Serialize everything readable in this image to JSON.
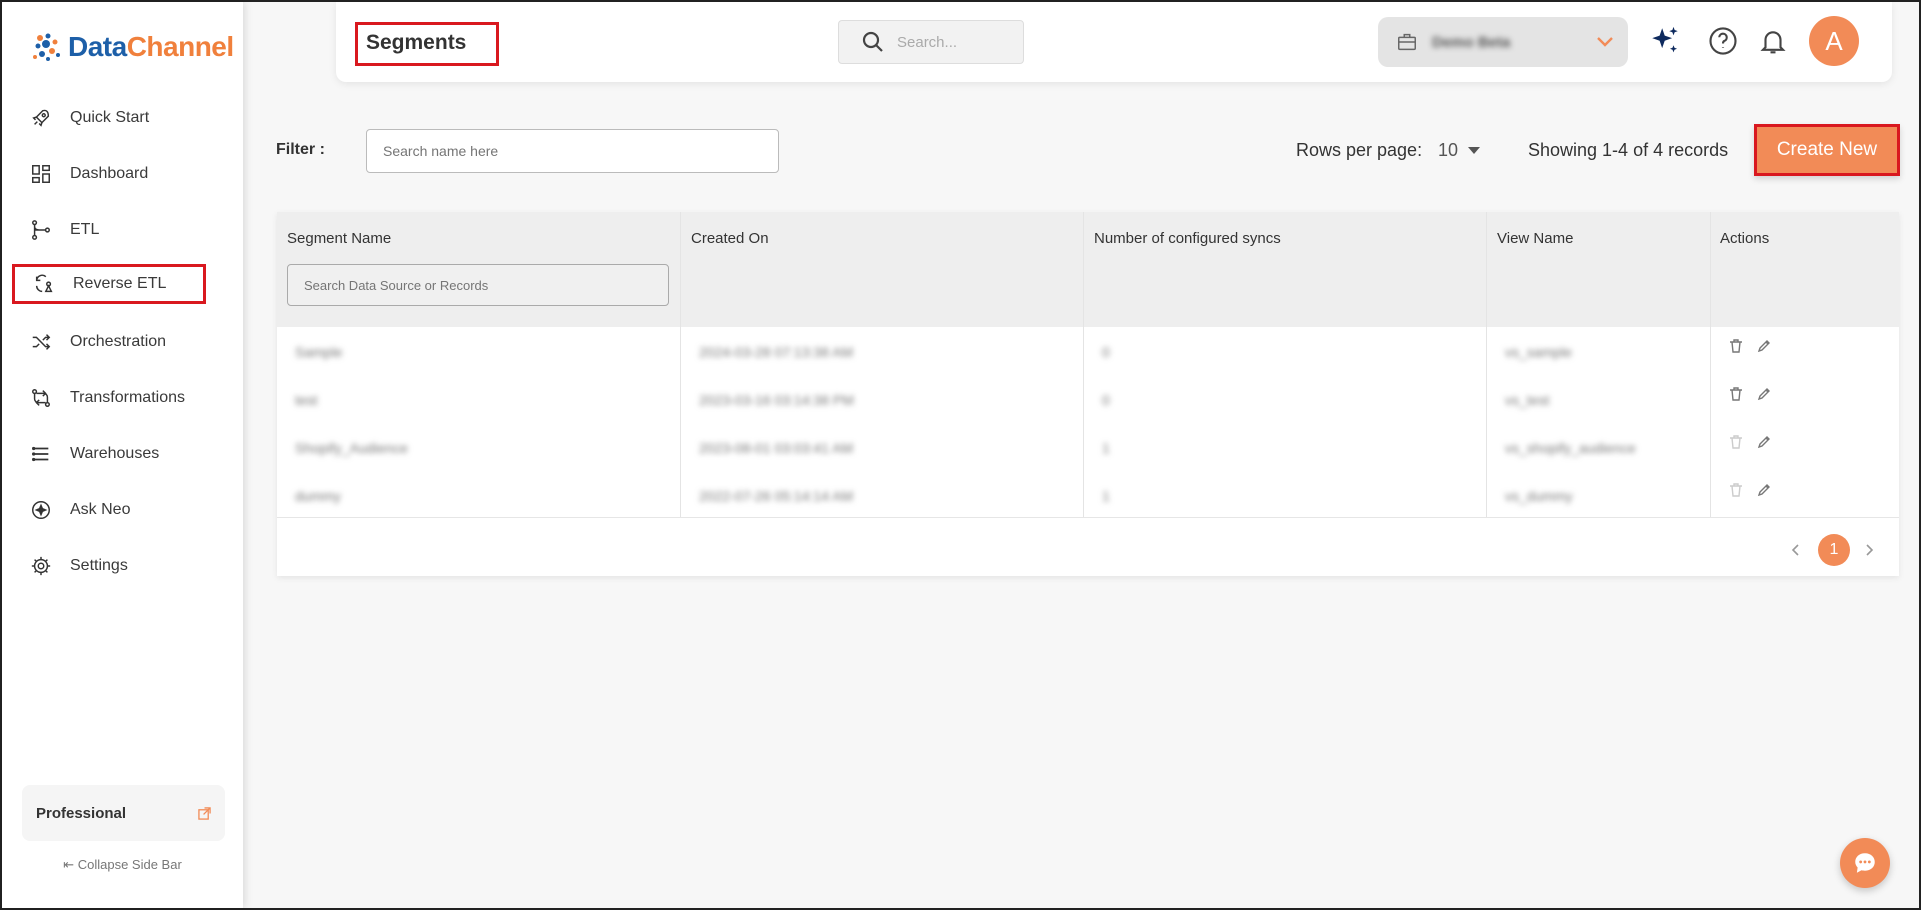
{
  "app": {
    "logo_part1": "Data",
    "logo_part2": "Channel"
  },
  "sidebar": {
    "items": [
      {
        "label": "Quick Start",
        "icon": "rocket-icon"
      },
      {
        "label": "Dashboard",
        "icon": "grid-icon"
      },
      {
        "label": "ETL",
        "icon": "flow-icon"
      },
      {
        "label": "Reverse ETL",
        "icon": "reverse-flow-icon"
      },
      {
        "label": "Orchestration",
        "icon": "shuffle-icon"
      },
      {
        "label": "Transformations",
        "icon": "transform-icon"
      },
      {
        "label": "Warehouses",
        "icon": "list-icon"
      },
      {
        "label": "Ask Neo",
        "icon": "sparkle-circle-icon"
      },
      {
        "label": "Settings",
        "icon": "gear-icon"
      }
    ],
    "plan": "Professional",
    "collapse": "Collapse Side Bar"
  },
  "header": {
    "title": "Segments",
    "search_placeholder": "Search...",
    "workspace": "Demo Beta",
    "avatar_letter": "A"
  },
  "toolbar": {
    "filter_label": "Filter :",
    "filter_placeholder": "Search name here",
    "rows_per_page_label": "Rows per page:",
    "rows_per_page_value": "10",
    "records_text": "Showing 1-4 of 4 records",
    "create_label": "Create New"
  },
  "table": {
    "columns": [
      "Segment Name",
      "Created On",
      "Number of configured syncs",
      "View Name",
      "Actions"
    ],
    "name_search_placeholder": "Search Data Source or Records",
    "rows": [
      {
        "name": "Sample",
        "created": "2024-03-28 07:13:38 AM",
        "syncs": "0",
        "view": "vs_sample"
      },
      {
        "name": "test",
        "created": "2023-03-16 03:14:38 PM",
        "syncs": "0",
        "view": "vs_test"
      },
      {
        "name": "Shopify_Audience",
        "created": "2023-08-01 03:03:41 AM",
        "syncs": "1",
        "view": "vs_shopify_audience"
      },
      {
        "name": "dummy",
        "created": "2022-07-26 05:14:14 AM",
        "syncs": "1",
        "view": "vs_dummy"
      }
    ],
    "current_page": "1"
  },
  "colors": {
    "accent": "#f28b57",
    "highlight": "#d9181f"
  }
}
